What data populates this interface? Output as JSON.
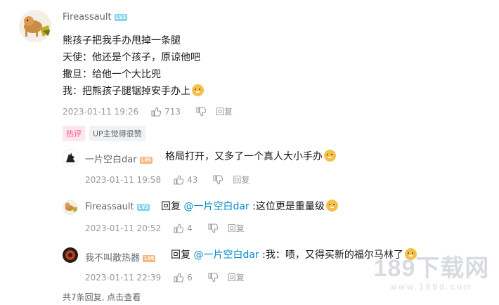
{
  "main_comment": {
    "username": "Fireassault",
    "level": "LV3",
    "lines": [
      "熊孩子把我手办甩掉一条腿",
      "天使：他还是个孩子，原谅他吧",
      "撒旦：给他一个大比兜",
      "我：把熊孩子腿锯掉安手办上"
    ],
    "time": "2023-01-11 19:26",
    "likes": "713",
    "reply_label": "回复",
    "tags": [
      "热评",
      "UP主觉得很赞"
    ]
  },
  "replies": [
    {
      "username": "一片空白dar",
      "level": "LV6",
      "prefix": "",
      "mention": "",
      "text": "格局打开，又多了一个真人大小手办",
      "time": "2023-01-11 19:58",
      "likes": "43",
      "reply_label": "回复"
    },
    {
      "username": "Fireassault",
      "level": "LV3",
      "prefix": "回复 ",
      "mention": "@一片空白dar",
      "text": " :这位更是重量级",
      "time": "2023-01-11 20:52",
      "likes": "4",
      "reply_label": "回复"
    },
    {
      "username": "我不叫散热器",
      "level": "LV6",
      "prefix": "回复 ",
      "mention": "@一片空白dar",
      "text": " :我：啧，又得买新的福尔马林了",
      "time": "2023-01-11 22:39",
      "likes": "6",
      "reply_label": "回复"
    }
  ],
  "footer": {
    "text": "共7条回复, 点击查看"
  },
  "watermark": {
    "main": "189下载网",
    "sub": "www.189d.com"
  },
  "colors": {
    "mention": "#008ac5",
    "hot_tag": "#f25d8e",
    "meta": "#9499a0"
  }
}
